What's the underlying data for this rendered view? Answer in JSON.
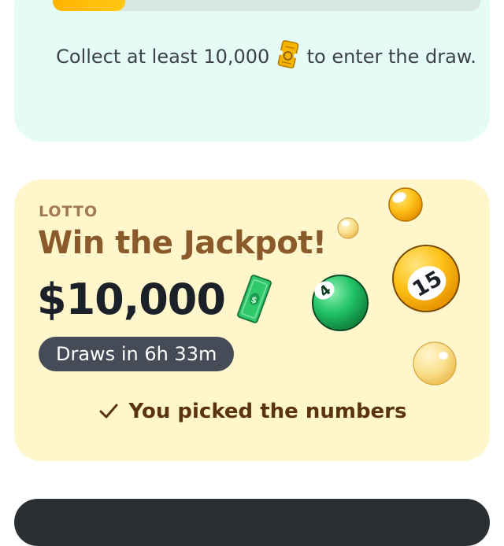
{
  "top": {
    "progress_fraction": 0.17,
    "collect_text_before": "Collect at least 10,000",
    "collect_text_after": "to enter the draw.",
    "ticket_icon": "golden-ticket-icon"
  },
  "lotto": {
    "label": "LOTTO",
    "headline": "Win the Jackpot!",
    "amount": "$10,000",
    "cash_icon": "cash-bill-icon",
    "timer": "Draws in 6h 33m",
    "picked_text": "You picked the numbers",
    "ball_numbers": {
      "green": "4",
      "big_yellow": "15"
    }
  },
  "colors": {
    "accent_yellow": "#ffbf00",
    "card_mint": "#e4fbf6",
    "card_cream": "#fff6cc",
    "headline_brown": "#8b5a2b",
    "pill_dark": "#454b57"
  }
}
